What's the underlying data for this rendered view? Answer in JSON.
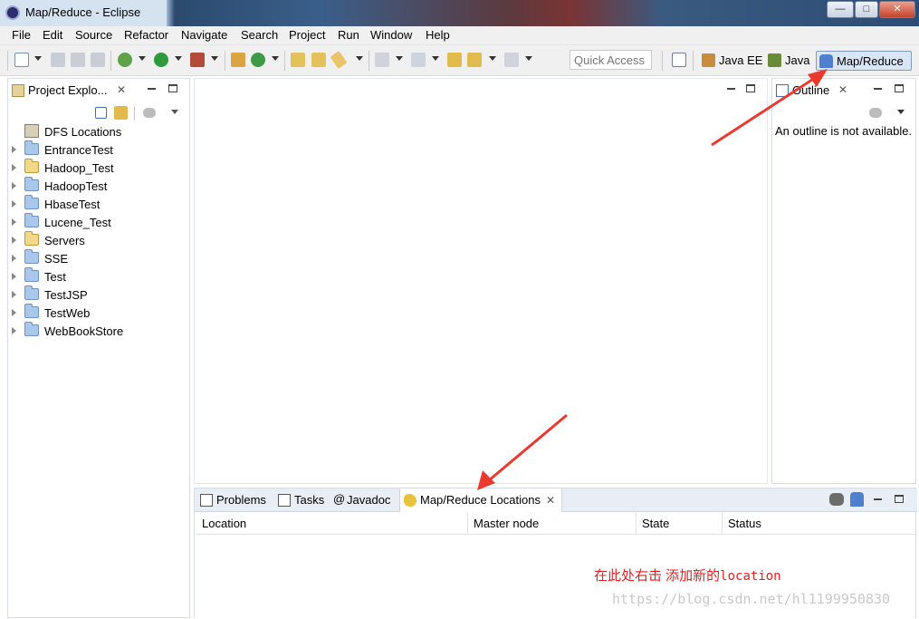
{
  "window": {
    "title": "Map/Reduce - Eclipse",
    "controls": {
      "minimize": "—",
      "maximize": "□",
      "close": "✕"
    }
  },
  "menu": [
    "File",
    "Edit",
    "Source",
    "Refactor",
    "Navigate",
    "Search",
    "Project",
    "Run",
    "Window",
    "Help"
  ],
  "toolbar": {
    "quick_access": "Quick Access",
    "perspectives": [
      {
        "label": "Java EE",
        "icon": "java-ee-perspective-icon"
      },
      {
        "label": "Java",
        "icon": "java-perspective-icon"
      },
      {
        "label": "Map/Reduce",
        "icon": "elephant-icon",
        "active": true
      }
    ]
  },
  "project_explorer": {
    "title": "Project Explo...",
    "items": [
      {
        "label": "DFS Locations",
        "icon": "dfs-locations-icon",
        "expandable": false
      },
      {
        "label": "EntranceTest",
        "icon": "folder-icon",
        "expandable": true
      },
      {
        "label": "Hadoop_Test",
        "icon": "open-folder-icon",
        "expandable": true
      },
      {
        "label": "HadoopTest",
        "icon": "folder-icon",
        "expandable": true
      },
      {
        "label": "HbaseTest",
        "icon": "folder-icon",
        "expandable": true
      },
      {
        "label": "Lucene_Test",
        "icon": "folder-icon",
        "expandable": true
      },
      {
        "label": "Servers",
        "icon": "open-folder-icon",
        "expandable": true
      },
      {
        "label": "SSE",
        "icon": "folder-icon",
        "expandable": true
      },
      {
        "label": "Test",
        "icon": "folder-icon",
        "expandable": true
      },
      {
        "label": "TestJSP",
        "icon": "folder-icon",
        "expandable": true
      },
      {
        "label": "TestWeb",
        "icon": "folder-icon",
        "expandable": true
      },
      {
        "label": "WebBookStore",
        "icon": "folder-icon",
        "expandable": true
      }
    ]
  },
  "outline": {
    "title": "Outline",
    "message": "An outline is not available."
  },
  "bottom_panel": {
    "tabs": [
      {
        "label": "Problems",
        "icon": "problems-icon"
      },
      {
        "label": "Tasks",
        "icon": "tasks-icon"
      },
      {
        "label": "Javadoc",
        "icon": "javadoc-at-icon"
      },
      {
        "label": "Map/Reduce Locations",
        "icon": "mapreduce-locations-icon",
        "active": true
      }
    ],
    "columns": [
      "Location",
      "Master node",
      "State",
      "Status"
    ],
    "rows": []
  },
  "annotation": {
    "text": "在此处右击 添加新的",
    "text_mono": "location",
    "color": "#e02020"
  },
  "watermark": "https://blog.csdn.net/hl1199950830"
}
